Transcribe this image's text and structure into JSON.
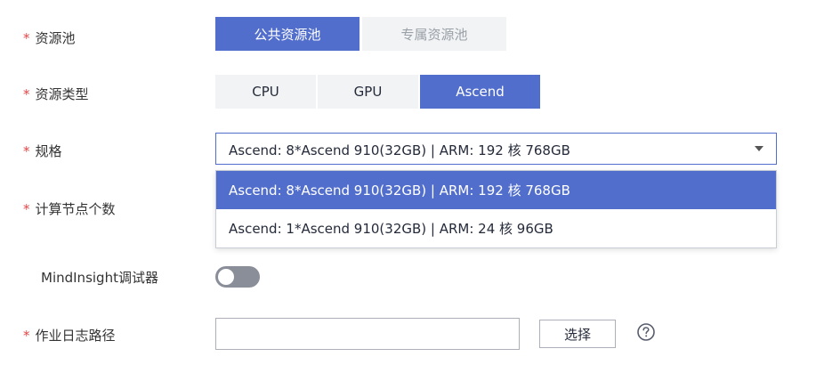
{
  "resource_pool": {
    "label": "资源池",
    "required_mark": "*",
    "options": [
      "公共资源池",
      "专属资源池"
    ],
    "selected": "公共资源池"
  },
  "resource_type": {
    "label": "资源类型",
    "required_mark": "*",
    "options": [
      "CPU",
      "GPU",
      "Ascend"
    ],
    "selected": "Ascend"
  },
  "spec": {
    "label": "规格",
    "required_mark": "*",
    "value": "Ascend: 8*Ascend 910(32GB) | ARM: 192 核 768GB",
    "dropdown_options": [
      "Ascend: 8*Ascend 910(32GB) | ARM: 192 核 768GB",
      "Ascend: 1*Ascend 910(32GB) | ARM: 24 核 96GB"
    ]
  },
  "compute_nodes": {
    "label": "计算节点个数",
    "required_mark": "*"
  },
  "mindinsight": {
    "label": "MindInsight调试器",
    "enabled": false
  },
  "job_log_path": {
    "label": "作业日志路径",
    "required_mark": "*",
    "value": "",
    "select_button": "选择",
    "help_icon": "question-circle-icon"
  },
  "colors": {
    "accent": "#526ecc",
    "required": "#e54545",
    "toggle_off": "#8a8e99"
  }
}
